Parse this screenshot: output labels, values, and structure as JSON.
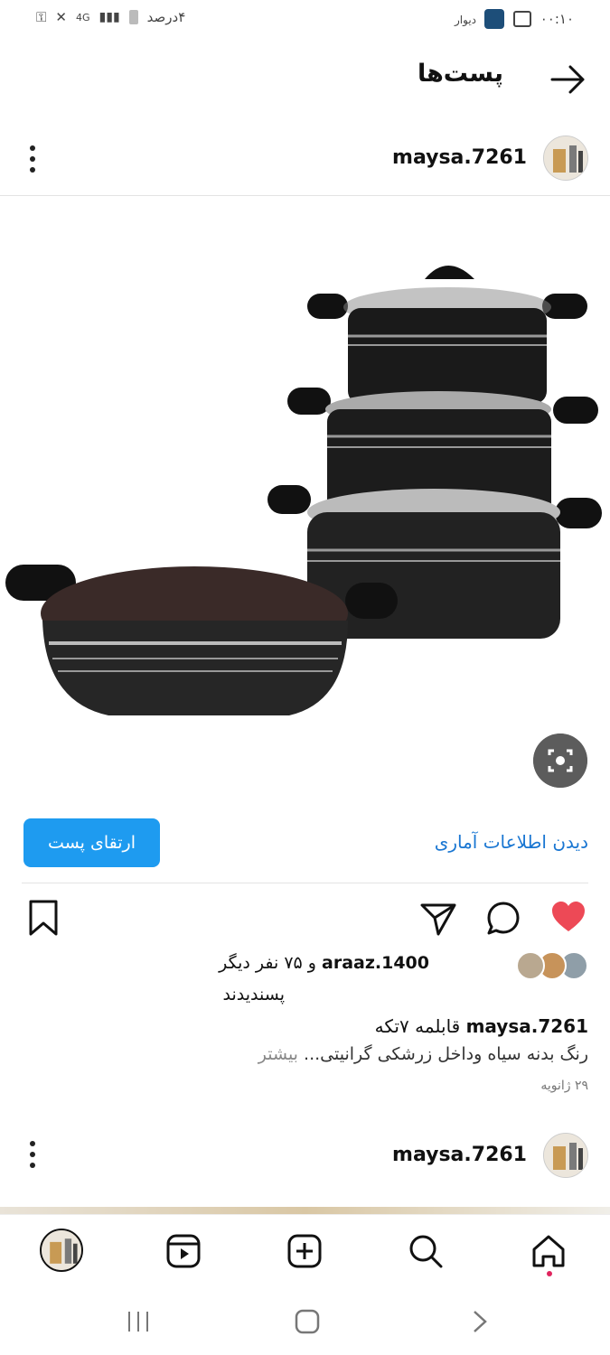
{
  "status_bar": {
    "time": "۰۰:۱۰",
    "app_label": "دیوار",
    "battery_text": "۴درصد",
    "network": "4G"
  },
  "header": {
    "title": "پست‌ها"
  },
  "post": {
    "username": "maysa.7261",
    "boost_label": "ارتقای پست",
    "insights_label": "دیدن اطلاعات آماری",
    "liked_by_user": "araaz.1400",
    "liked_by_rest": "و ۷۵ نفر دیگر",
    "liked_suffix": "پسندیدند",
    "caption_username": "maysa.7261",
    "caption_text": "قابلمه ۷تکه",
    "caption_line2": "رنگ بدنه سیاه وداخل زرشکی گرانیتی...",
    "more_label": "بیشتر",
    "date": "۲۹ ژانویه",
    "liked": true,
    "like_color": "#ed4956"
  },
  "next_post": {
    "username": "maysa.7261"
  },
  "colors": {
    "accent": "#1e9bf0",
    "link": "#1976d2"
  }
}
